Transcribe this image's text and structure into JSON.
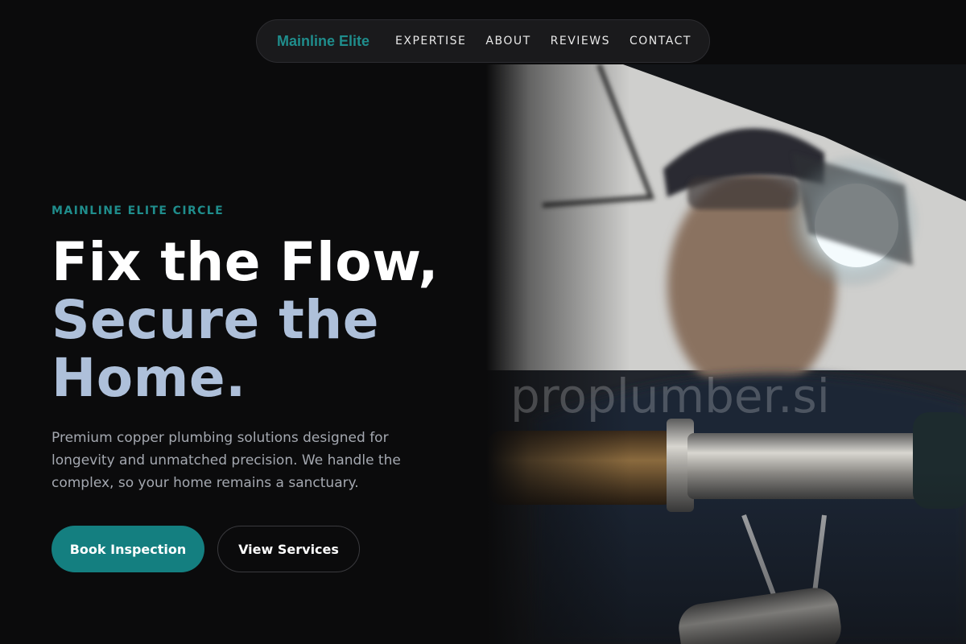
{
  "nav": {
    "brand": "Mainline Elite",
    "links": [
      "EXPERTISE",
      "ABOUT",
      "REVIEWS",
      "CONTACT"
    ]
  },
  "hero": {
    "eyebrow": "MAINLINE ELITE CIRCLE",
    "headline_line1": "Fix the Flow,",
    "headline_line2": "Secure the",
    "headline_line3": "Home.",
    "description": "Premium copper plumbing solutions designed for longevity and unmatched precision. We handle the complex, so your home remains a sanctuary.",
    "primary_button": "Book Inspection",
    "secondary_button": "View Services",
    "image_watermark": "proplumber.si"
  },
  "colors": {
    "accent": "#1f8d8c",
    "button_primary": "#147f80",
    "headline_secondary": "#aec0da",
    "background": "#0b0b0c"
  }
}
